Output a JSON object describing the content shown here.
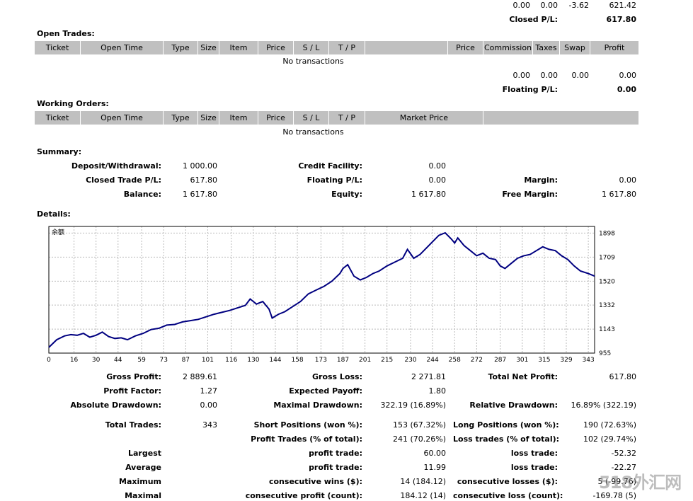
{
  "top_row": {
    "v1": "0.00",
    "v2": "0.00",
    "v3": "-3.62",
    "v4": "621.42"
  },
  "closed_pl": {
    "label": "Closed P/L:",
    "value": "617.80"
  },
  "open_trades": {
    "title": "Open Trades:",
    "headers": [
      "Ticket",
      "Open Time",
      "Type",
      "Size",
      "Item",
      "Price",
      "S / L",
      "T / P",
      "",
      "Price",
      "Commission",
      "Taxes",
      "Swap",
      "Profit"
    ],
    "empty": "No transactions",
    "totals": {
      "commission": "0.00",
      "taxes": "0.00",
      "swap": "0.00",
      "profit": "0.00"
    },
    "floating_label": "Floating P/L:",
    "floating_value": "0.00"
  },
  "working_orders": {
    "title": "Working Orders:",
    "headers": [
      "Ticket",
      "Open Time",
      "Type",
      "Size",
      "Item",
      "Price",
      "S / L",
      "T / P",
      "Market Price",
      ""
    ],
    "empty": "No transactions"
  },
  "summary": {
    "title": "Summary:",
    "deposit_label": "Deposit/Withdrawal:",
    "deposit_value": "1 000.00",
    "credit_label": "Credit Facility:",
    "credit_value": "0.00",
    "closed_label": "Closed Trade P/L:",
    "closed_value": "617.80",
    "floating_label": "Floating P/L:",
    "floating_value": "0.00",
    "margin_label": "Margin:",
    "margin_value": "0.00",
    "balance_label": "Balance:",
    "balance_value": "1 617.80",
    "equity_label": "Equity:",
    "equity_value": "1 617.80",
    "free_margin_label": "Free Margin:",
    "free_margin_value": "1 617.80"
  },
  "details": {
    "title": "Details:"
  },
  "chart_data": {
    "type": "line",
    "title": "余额",
    "series": [
      {
        "name": "余额",
        "color": "#000080"
      }
    ],
    "x_ticks": [
      0,
      16,
      30,
      44,
      59,
      73,
      87,
      101,
      116,
      130,
      144,
      158,
      173,
      187,
      201,
      215,
      230,
      244,
      258,
      272,
      287,
      301,
      315,
      329,
      343
    ],
    "y_ticks": [
      955,
      1143,
      1332,
      1520,
      1709,
      1898
    ],
    "xlim": [
      0,
      347
    ],
    "ylim": [
      955,
      1950
    ],
    "grid": true,
    "x": [
      0,
      5,
      10,
      14,
      18,
      22,
      26,
      30,
      34,
      38,
      42,
      46,
      50,
      55,
      60,
      65,
      70,
      75,
      80,
      85,
      90,
      95,
      100,
      105,
      110,
      115,
      120,
      125,
      128,
      132,
      136,
      140,
      142,
      146,
      150,
      155,
      160,
      165,
      170,
      175,
      180,
      185,
      187,
      190,
      194,
      198,
      202,
      206,
      210,
      215,
      220,
      225,
      228,
      232,
      236,
      240,
      244,
      248,
      252,
      256,
      258,
      260,
      264,
      268,
      272,
      276,
      280,
      284,
      287,
      290,
      294,
      298,
      302,
      306,
      310,
      314,
      318,
      322,
      326,
      330,
      334,
      338,
      343,
      347
    ],
    "y": [
      1000,
      1060,
      1090,
      1100,
      1095,
      1110,
      1080,
      1095,
      1120,
      1085,
      1070,
      1075,
      1060,
      1090,
      1110,
      1140,
      1150,
      1175,
      1180,
      1200,
      1210,
      1220,
      1240,
      1260,
      1275,
      1290,
      1310,
      1330,
      1380,
      1340,
      1360,
      1300,
      1230,
      1260,
      1280,
      1320,
      1360,
      1420,
      1450,
      1480,
      1520,
      1580,
      1620,
      1650,
      1560,
      1530,
      1550,
      1580,
      1600,
      1640,
      1670,
      1700,
      1770,
      1700,
      1730,
      1780,
      1830,
      1880,
      1900,
      1850,
      1820,
      1860,
      1800,
      1760,
      1720,
      1740,
      1700,
      1690,
      1640,
      1620,
      1660,
      1700,
      1720,
      1730,
      1760,
      1790,
      1770,
      1760,
      1720,
      1690,
      1640,
      1600,
      1580,
      1560
    ]
  },
  "stats": [
    {
      "l1": "Gross Profit:",
      "v1": "2 889.61",
      "l2": "Gross Loss:",
      "v2": "2 271.81",
      "l3": "Total Net Profit:",
      "v3": "617.80"
    },
    {
      "l1": "Profit Factor:",
      "v1": "1.27",
      "l2": "Expected Payoff:",
      "v2": "1.80",
      "l3": "",
      "v3": ""
    },
    {
      "l1": "Absolute Drawdown:",
      "v1": "0.00",
      "l2": "Maximal Drawdown:",
      "v2": "322.19 (16.89%)",
      "l3": "Relative Drawdown:",
      "v3": "16.89% (322.19)"
    },
    {
      "l1": "Total Trades:",
      "v1": "343",
      "l2": "Short Positions (won %):",
      "v2": "153 (67.32%)",
      "l3": "Long Positions (won %):",
      "v3": "190 (72.63%)"
    },
    {
      "l1": "",
      "v1": "",
      "l2": "Profit Trades (% of total):",
      "v2": "241 (70.26%)",
      "l3": "Loss trades (% of total):",
      "v3": "102 (29.74%)"
    },
    {
      "l1": "Largest",
      "v1": "",
      "l2": "profit trade:",
      "v2": "60.00",
      "l3": "loss trade:",
      "v3": "-52.32"
    },
    {
      "l1": "Average",
      "v1": "",
      "l2": "profit trade:",
      "v2": "11.99",
      "l3": "loss trade:",
      "v3": "-22.27"
    },
    {
      "l1": "Maximum",
      "v1": "",
      "l2": "consecutive wins ($):",
      "v2": "14 (184.12)",
      "l3": "consecutive losses ($):",
      "v3": "5 (-99.76)"
    },
    {
      "l1": "Maximal",
      "v1": "",
      "l2": "consecutive profit (count):",
      "v2": "184.12 (14)",
      "l3": "consecutive loss (count):",
      "v3": "-169.78 (5)"
    }
  ],
  "watermark": "518外汇网"
}
